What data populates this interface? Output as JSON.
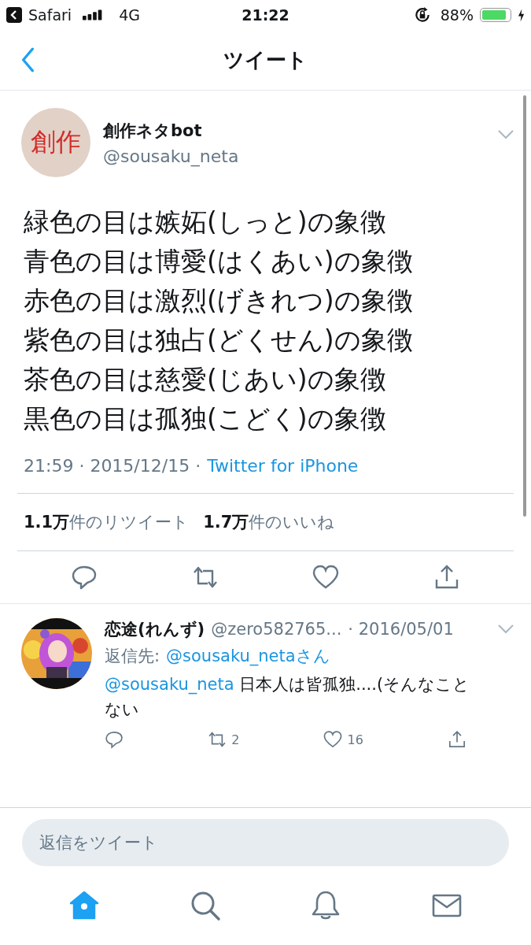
{
  "status_bar": {
    "back_app": "Safari",
    "network": "4G",
    "time": "21:22",
    "battery": "88%"
  },
  "nav": {
    "title": "ツイート"
  },
  "tweet": {
    "author": "創作ネタbot",
    "handle": "@sousaku_neta",
    "avatar_text": "創作",
    "lines": [
      "緑色の目は嫉妬(しっと)の象徴",
      "青色の目は博愛(はくあい)の象徴",
      "赤色の目は激烈(げきれつ)の象徴",
      "紫色の目は独占(どくせん)の象徴",
      "茶色の目は慈愛(じあい)の象徴",
      "黒色の目は孤独(こどく)の象徴"
    ],
    "time": "21:59 · 2015/12/15 ·",
    "source": "Twitter for iPhone",
    "stats": [
      {
        "count": "1.1万",
        "label": "件のリツイート"
      },
      {
        "count": "1.7万",
        "label": "件のいいね"
      }
    ]
  },
  "reply": {
    "author": "恋途(れんず)",
    "handle": "@zero582765...",
    "date": "· 2016/05/01",
    "reply_to_label": "返信先:",
    "reply_to": "@sousaku_netaさん",
    "mention": "@sousaku_neta",
    "text": "日本人は皆孤独....(そんなことない",
    "retweets": "2",
    "likes": "16"
  },
  "composer": {
    "placeholder": "返信をツイート"
  },
  "tab_bar": [
    {
      "kind": "home",
      "selected": true
    },
    {
      "kind": "search",
      "selected": false
    },
    {
      "kind": "bell",
      "selected": false
    },
    {
      "kind": "mail",
      "selected": false
    }
  ]
}
